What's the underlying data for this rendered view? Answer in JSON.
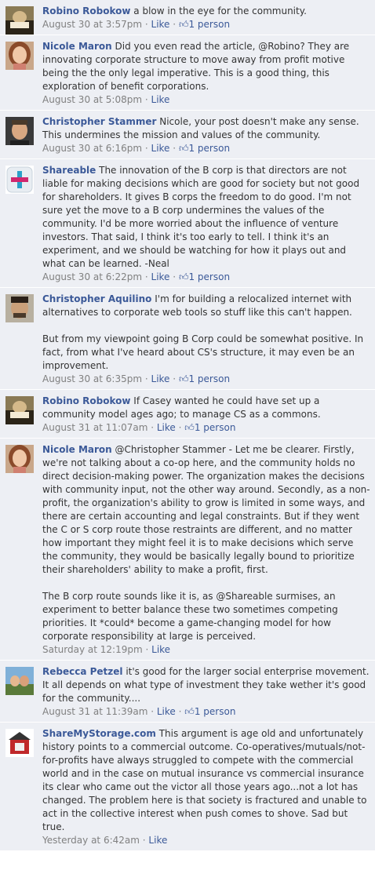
{
  "comments": [
    {
      "author": "Robino Robokow",
      "avatar": "avatar-robino",
      "paragraphs": [
        "a blow in the eye for the community."
      ],
      "timestamp": "August 30 at 3:57pm",
      "like_label": "Like",
      "likes": "1 person"
    },
    {
      "author": "Nicole Maron",
      "avatar": "avatar-nicole",
      "paragraphs": [
        "Did you even read the article, @Robino? They are innovating corporate structure to move away from profit motive being the the only legal imperative. This is a good thing, this exploration of benefit corporations."
      ],
      "timestamp": "August 30 at 5:08pm",
      "like_label": "Like",
      "likes": ""
    },
    {
      "author": "Christopher Stammer",
      "avatar": "avatar-christopher-stammer",
      "paragraphs": [
        "Nicole, your post doesn't make any sense. This undermines the mission and values of the community."
      ],
      "timestamp": "August 30 at 6:16pm",
      "like_label": "Like",
      "likes": "1 person"
    },
    {
      "author": "Shareable",
      "avatar": "avatar-shareable-logo",
      "paragraphs": [
        "The innovation of the B corp is that directors are not liable for making decisions which are good for society but not good for shareholders. It gives B corps the freedom to do good. I'm not sure yet the move to a B corp undermines the values of the community. I'd be more worried about the influence of venture investors. That said, I think it's too early to tell. I think it's an experiment, and we should be watching for how it plays out and what can be learned. -Neal"
      ],
      "timestamp": "August 30 at 6:22pm",
      "like_label": "Like",
      "likes": "1 person"
    },
    {
      "author": "Christopher Aquilino",
      "avatar": "avatar-christopher-aquilino",
      "paragraphs": [
        "I'm for building a relocalized internet with alternatives to corporate web tools so stuff like this can't happen.",
        "But from my viewpoint going B Corp could be somewhat positive. In fact, from what I've heard about CS's structure, it may even be an improvement."
      ],
      "timestamp": "August 30 at 6:35pm",
      "like_label": "Like",
      "likes": "1 person"
    },
    {
      "author": "Robino Robokow",
      "avatar": "avatar-robino",
      "paragraphs": [
        "If Casey wanted he could have set up a community model ages ago; to manage CS as a commons."
      ],
      "timestamp": "August 31 at 11:07am",
      "like_label": "Like",
      "likes": "1 person"
    },
    {
      "author": "Nicole Maron",
      "avatar": "avatar-nicole",
      "paragraphs": [
        "@Christopher Stammer - Let me be clearer. Firstly, we're not talking about a co-op here, and the community holds no direct decision-making power. The organization makes the decisions with community input, not the other way around. Secondly, as a non-profit, the organization's ability to grow is limited in some ways, and there are certain accounting and legal constraints. But if they went the C or S corp route those restraints are different, and no matter how important they might feel it is to make decisions which serve the community, they would be basically legally bound to prioritize their shareholders' ability to make a profit, first.",
        "The B corp route sounds like it is, as @Shareable surmises, an experiment to better balance these two sometimes competing priorities. It *could* become a game-changing model for how corporate responsibility at large is perceived."
      ],
      "timestamp": "Saturday at 12:19pm",
      "like_label": "Like",
      "likes": ""
    },
    {
      "author": "Rebecca Petzel",
      "avatar": "avatar-rebecca",
      "paragraphs": [
        "it's good for the larger social enterprise movement. It all depends on what type of investment they take wether it's good for the community...."
      ],
      "timestamp": "August 31 at 11:39am",
      "like_label": "Like",
      "likes": "1 person"
    },
    {
      "author": "ShareMyStorage.com",
      "avatar": "avatar-sharemystorage-logo",
      "paragraphs": [
        "This argument is age old and unfortunately history points to a commercial outcome. Co-operatives/mutuals/not-for-profits have always struggled to compete with the commercial world and in the case on mutual insurance vs commercial insurance its clear who came out the victor all those years ago...not a lot has changed. The problem here is that society is fractured and unable to act in the collective interest when push comes to shove. Sad but true."
      ],
      "timestamp": "Yesterday at 6:42am",
      "like_label": "Like",
      "likes": ""
    }
  ]
}
